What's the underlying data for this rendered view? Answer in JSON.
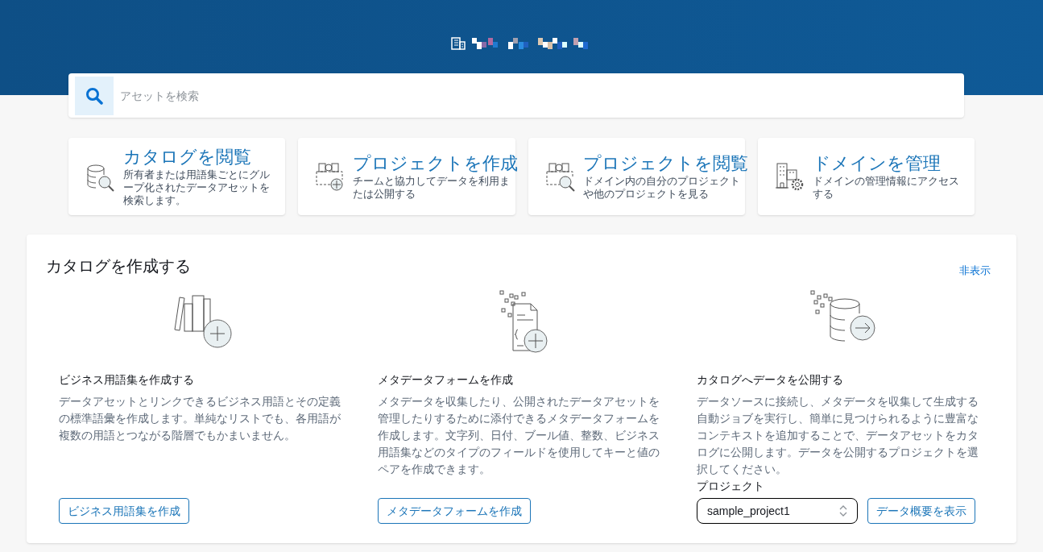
{
  "search": {
    "placeholder": "アセットを検索"
  },
  "quick_actions": [
    {
      "kind": "browse-catalog",
      "title": "カタログを閲覧",
      "description": "所有者または用語集ごとにグループ化されたデータアセットを検索します。"
    },
    {
      "kind": "create-project",
      "title": "プロジェクトを作成",
      "description": "チームと協力してデータを利用または公開する"
    },
    {
      "kind": "browse-project",
      "title": "プロジェクトを閲覧",
      "description": "ドメイン内の自分のプロジェクトや他のプロジェクトを見る"
    },
    {
      "kind": "manage-domain",
      "title": "ドメインを管理",
      "description": "ドメインの管理情報にアクセスする"
    }
  ],
  "catalog_panel": {
    "title": "カタログを作成する",
    "hide_link": "非表示",
    "columns": [
      {
        "kind": "glossary",
        "heading": "ビジネス用語集を作成する",
        "description": "データアセットとリンクできるビジネス用語とその定義の標準語彙を作成します。単純なリストでも、各用語が複数の用語とつながる階層でもかまいません。",
        "button": "ビジネス用語集を作成"
      },
      {
        "kind": "form",
        "heading": "メタデータフォームを作成",
        "description": "メタデータを収集したり、公開されたデータアセットを管理したりするために添付できるメタデータフォームを作成します。文字列、日付、ブール値、整数、ビジネス用語集などのタイプのフィールドを使用してキーと値のペアを作成できます。",
        "button": "メタデータフォームを作成"
      },
      {
        "kind": "publish",
        "heading": "カタログへデータを公開する",
        "description": "データソースに接続し、メタデータを収集して生成する自動ジョブを実行し、簡単に見つけられるように豊富なコンテキストを追加することで、データアセットをカタログに公開します。データを公開するプロジェクトを選択してください。",
        "select_label": "プロジェクト",
        "select_value": "sample_project1",
        "button": "データ概要を表示"
      }
    ]
  }
}
